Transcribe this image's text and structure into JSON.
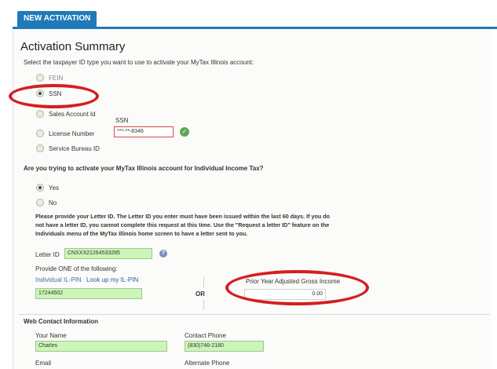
{
  "tab": {
    "label": "NEW ACTIVATION"
  },
  "summary": {
    "title": "Activation Summary",
    "instruction": "Select the taxpayer ID type you want to use to activate your MyTax Illinois account:",
    "id_types": [
      "FEIN",
      "SSN",
      "Sales Account Id",
      "License Number",
      "Service Bureau ID"
    ],
    "selected_id_type": "SSN",
    "ssn_label": "SSN",
    "ssn_value": "***-**-8346"
  },
  "income_tax": {
    "question": "Are you trying to activate your MyTax Illinois account for Individual Income Tax?",
    "options": [
      "Yes",
      "No"
    ],
    "selected": "Yes"
  },
  "letter": {
    "notice_line1": "Please provide your Letter ID. The Letter ID you enter must have been issued within the last 60 days. If you do",
    "notice_line2": "not have a letter ID, you cannot complete this request at this time. Use the \"Request a letter ID\" feature on the",
    "notice_line3": "Individuals menu of the MyTax Illinois home screen to have a letter sent to you.",
    "label": "Letter ID",
    "value": "CNXXX21264533285",
    "provide_one": "Provide ONE of the following:",
    "il_pin_label": "Individual IL-PIN",
    "il_pin_link": "Look up my IL-PIN",
    "il_pin_value": "17244502",
    "or_label": "OR",
    "agi_label": "Prior Year Adjusted Gross Income",
    "agi_value": "0.00"
  },
  "contact": {
    "section_title": "Web Contact Information",
    "name_label": "Your Name",
    "name_value": "Charles",
    "phone_label": "Contact Phone",
    "phone_value": "(830)746-2180",
    "email_label": "Email",
    "alt_phone_label": "Alternate Phone"
  },
  "colors": {
    "accent": "#1f7ab8",
    "highlight_oval": "#d41f1f",
    "field_fill": "#ccf5b8"
  },
  "icons": {
    "valid": "check-circle-icon",
    "help": "question-circle-icon"
  }
}
